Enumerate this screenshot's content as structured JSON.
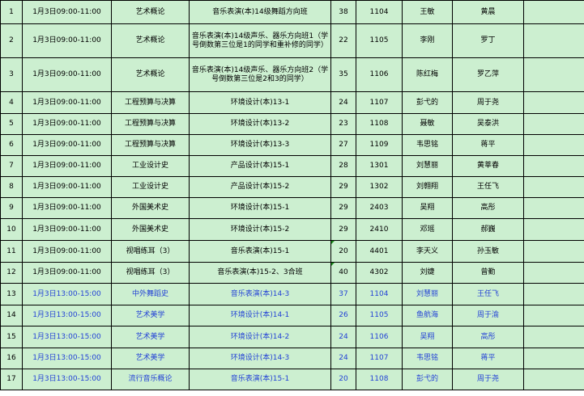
{
  "rows": [
    {
      "no": "1",
      "time": "1月3日09:00-11:00",
      "course": "艺术概论",
      "class": "音乐表演(本)14级舞蹈方向班",
      "count": "38",
      "room": "1104",
      "t1": "王敏",
      "t2": "黄晨",
      "blue": false,
      "h": 29,
      "marker": false
    },
    {
      "no": "2",
      "time": "1月3日09:00-11:00",
      "course": "艺术概论",
      "class": "音乐表演(本)14级声乐、器乐方向班1（学号倒数第三位是1的同学和重补修的同学）",
      "count": "22",
      "room": "1105",
      "t1": "李刚",
      "t2": "罗丁",
      "blue": false,
      "h": 42,
      "marker": false
    },
    {
      "no": "3",
      "time": "1月3日09:00-11:00",
      "course": "艺术概论",
      "class": "音乐表演(本)14级声乐、器乐方向班2（学号倒数第三位是2和3的同学）",
      "count": "35",
      "room": "1106",
      "t1": "陈红梅",
      "t2": "罗乙萍",
      "blue": false,
      "h": 42,
      "marker": false
    },
    {
      "no": "4",
      "time": "1月3日09:00-11:00",
      "course": "工程预算与决算",
      "class": "环境设计(本)13-1",
      "count": "24",
      "room": "1107",
      "t1": "彭弋的",
      "t2": "周于尧",
      "blue": false,
      "h": 27,
      "marker": false
    },
    {
      "no": "5",
      "time": "1月3日09:00-11:00",
      "course": "工程预算与决算",
      "class": "环境设计(本)13-2",
      "count": "23",
      "room": "1108",
      "t1": "聂敏",
      "t2": "吴泰洪",
      "blue": false,
      "h": 26,
      "marker": false
    },
    {
      "no": "6",
      "time": "1月3日09:00-11:00",
      "course": "工程预算与决算",
      "class": "环境设计(本)13-3",
      "count": "27",
      "room": "1109",
      "t1": "韦思铭",
      "t2": "蒋平",
      "blue": false,
      "h": 26,
      "marker": false
    },
    {
      "no": "7",
      "time": "1月3日09:00-11:00",
      "course": "工业设计史",
      "class": "产品设计(本)15-1",
      "count": "28",
      "room": "1301",
      "t1": "刘慧丽",
      "t2": "黄莘春",
      "blue": false,
      "h": 26,
      "marker": false
    },
    {
      "no": "8",
      "time": "1月3日09:00-11:00",
      "course": "工业设计史",
      "class": "产品设计(本)15-2",
      "count": "29",
      "room": "1302",
      "t1": "刘翱翔",
      "t2": "王任飞",
      "blue": false,
      "h": 26,
      "marker": false
    },
    {
      "no": "9",
      "time": "1月3日09:00-11:00",
      "course": "外国美术史",
      "class": "环境设计(本)15-1",
      "count": "29",
      "room": "2403",
      "t1": "吴翔",
      "t2": "高彤",
      "blue": false,
      "h": 26,
      "marker": false
    },
    {
      "no": "10",
      "time": "1月3日09:00-11:00",
      "course": "外国美术史",
      "class": "环境设计(本)15-2",
      "count": "29",
      "room": "2410",
      "t1": "邓瑶",
      "t2": "郝巍",
      "blue": false,
      "h": 27,
      "marker": false
    },
    {
      "no": "11",
      "time": "1月3日09:00-11:00",
      "course": "视唱练耳（3）",
      "class": "音乐表演(本)15-1",
      "count": "20",
      "room": "4401",
      "t1": "李天义",
      "t2": "孙玉敏",
      "blue": false,
      "h": 27,
      "marker": true
    },
    {
      "no": "12",
      "time": "1月3日09:00-11:00",
      "course": "视唱练耳（3）",
      "class": "音乐表演(本)15-2、3合班",
      "count": "40",
      "room": "4302",
      "t1": "刘婕",
      "t2": "曾勤",
      "blue": false,
      "h": 26,
      "marker": true
    },
    {
      "no": "13",
      "time": "1月3日13:00-15:00",
      "course": "中外舞蹈史",
      "class": "音乐表演(本)14-3",
      "count": "37",
      "room": "1104",
      "t1": "刘慧丽",
      "t2": "王任飞",
      "blue": true,
      "h": 27,
      "marker": false
    },
    {
      "no": "14",
      "time": "1月3日13:00-15:00",
      "course": "艺术美学",
      "class": "环境设计(本)14-1",
      "count": "26",
      "room": "1105",
      "t1": "鱼航海",
      "t2": "周于渝",
      "blue": true,
      "h": 26,
      "marker": false
    },
    {
      "no": "15",
      "time": "1月3日13:00-15:00",
      "course": "艺术美学",
      "class": "环境设计(本)14-2",
      "count": "24",
      "room": "1106",
      "t1": "吴翔",
      "t2": "高彤",
      "blue": true,
      "h": 27,
      "marker": false
    },
    {
      "no": "16",
      "time": "1月3日13:00-15:00",
      "course": "艺术美学",
      "class": "环境设计(本)14-3",
      "count": "24",
      "room": "1107",
      "t1": "韦思铭",
      "t2": "蒋平",
      "blue": true,
      "h": 26,
      "marker": false
    },
    {
      "no": "17",
      "time": "1月3日13:00-15:00",
      "course": "流行音乐概论",
      "class": "音乐表演(本)15-1",
      "count": "20",
      "room": "1108",
      "t1": "彭弋的",
      "t2": "周于尧",
      "blue": true,
      "h": 26,
      "marker": false
    }
  ]
}
